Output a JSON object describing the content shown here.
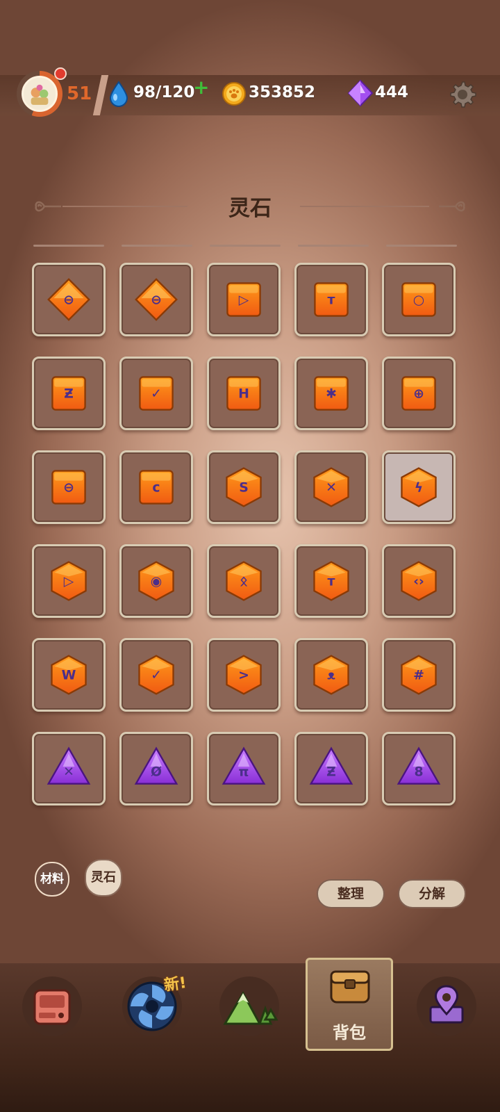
{
  "top_bar": {
    "level": "51",
    "energy": "98/120",
    "coins": "353852",
    "gems": "444"
  },
  "page_title": "灵石",
  "inventory": {
    "rows": [
      [
        {
          "shape": "diamond",
          "symbol": "⊖"
        },
        {
          "shape": "diamond",
          "symbol": "⊖"
        },
        {
          "shape": "square",
          "symbol": "▷"
        },
        {
          "shape": "square",
          "symbol": "ᴛ"
        },
        {
          "shape": "square",
          "symbol": "○"
        }
      ],
      [
        {
          "shape": "square",
          "symbol": "Ƶ"
        },
        {
          "shape": "square",
          "symbol": "✓"
        },
        {
          "shape": "square",
          "symbol": "H"
        },
        {
          "shape": "square",
          "symbol": "✱"
        },
        {
          "shape": "square",
          "symbol": "⊕"
        }
      ],
      [
        {
          "shape": "square",
          "symbol": "⊖"
        },
        {
          "shape": "square",
          "symbol": "ᴄ"
        },
        {
          "shape": "hexagon",
          "symbol": "S"
        },
        {
          "shape": "hexagon",
          "symbol": "✕"
        },
        {
          "shape": "hexagon",
          "symbol": "ϟ",
          "selected": true
        }
      ],
      [
        {
          "shape": "hexagon",
          "symbol": "▷"
        },
        {
          "shape": "hexagon",
          "symbol": "◉"
        },
        {
          "shape": "hexagon",
          "symbol": "ᛟ"
        },
        {
          "shape": "hexagon",
          "symbol": "ᴛ"
        },
        {
          "shape": "hexagon",
          "symbol": "‹›"
        }
      ],
      [
        {
          "shape": "hexagon",
          "symbol": "W"
        },
        {
          "shape": "hexagon",
          "symbol": "✓"
        },
        {
          "shape": "hexagon",
          "symbol": ">"
        },
        {
          "shape": "hexagon",
          "symbol": "ᴥ"
        },
        {
          "shape": "hexagon",
          "symbol": "#"
        }
      ],
      [
        {
          "shape": "triangle",
          "symbol": "✕"
        },
        {
          "shape": "triangle",
          "symbol": "Ø"
        },
        {
          "shape": "triangle",
          "symbol": "π"
        },
        {
          "shape": "triangle",
          "symbol": "Ƶ"
        },
        {
          "shape": "triangle",
          "symbol": "8"
        }
      ]
    ]
  },
  "filters": {
    "materials_label": "材料",
    "spirit_stone_label": "灵石"
  },
  "actions": {
    "sort_label": "整理",
    "decompose_label": "分解"
  },
  "nav": {
    "new_badge": "新!",
    "backpack_label": "背包"
  },
  "colors": {
    "orange_top": "#ff9a1a",
    "orange_bottom": "#f05a12",
    "purple": "#a04fe0",
    "rune": "#4b2e8a"
  }
}
